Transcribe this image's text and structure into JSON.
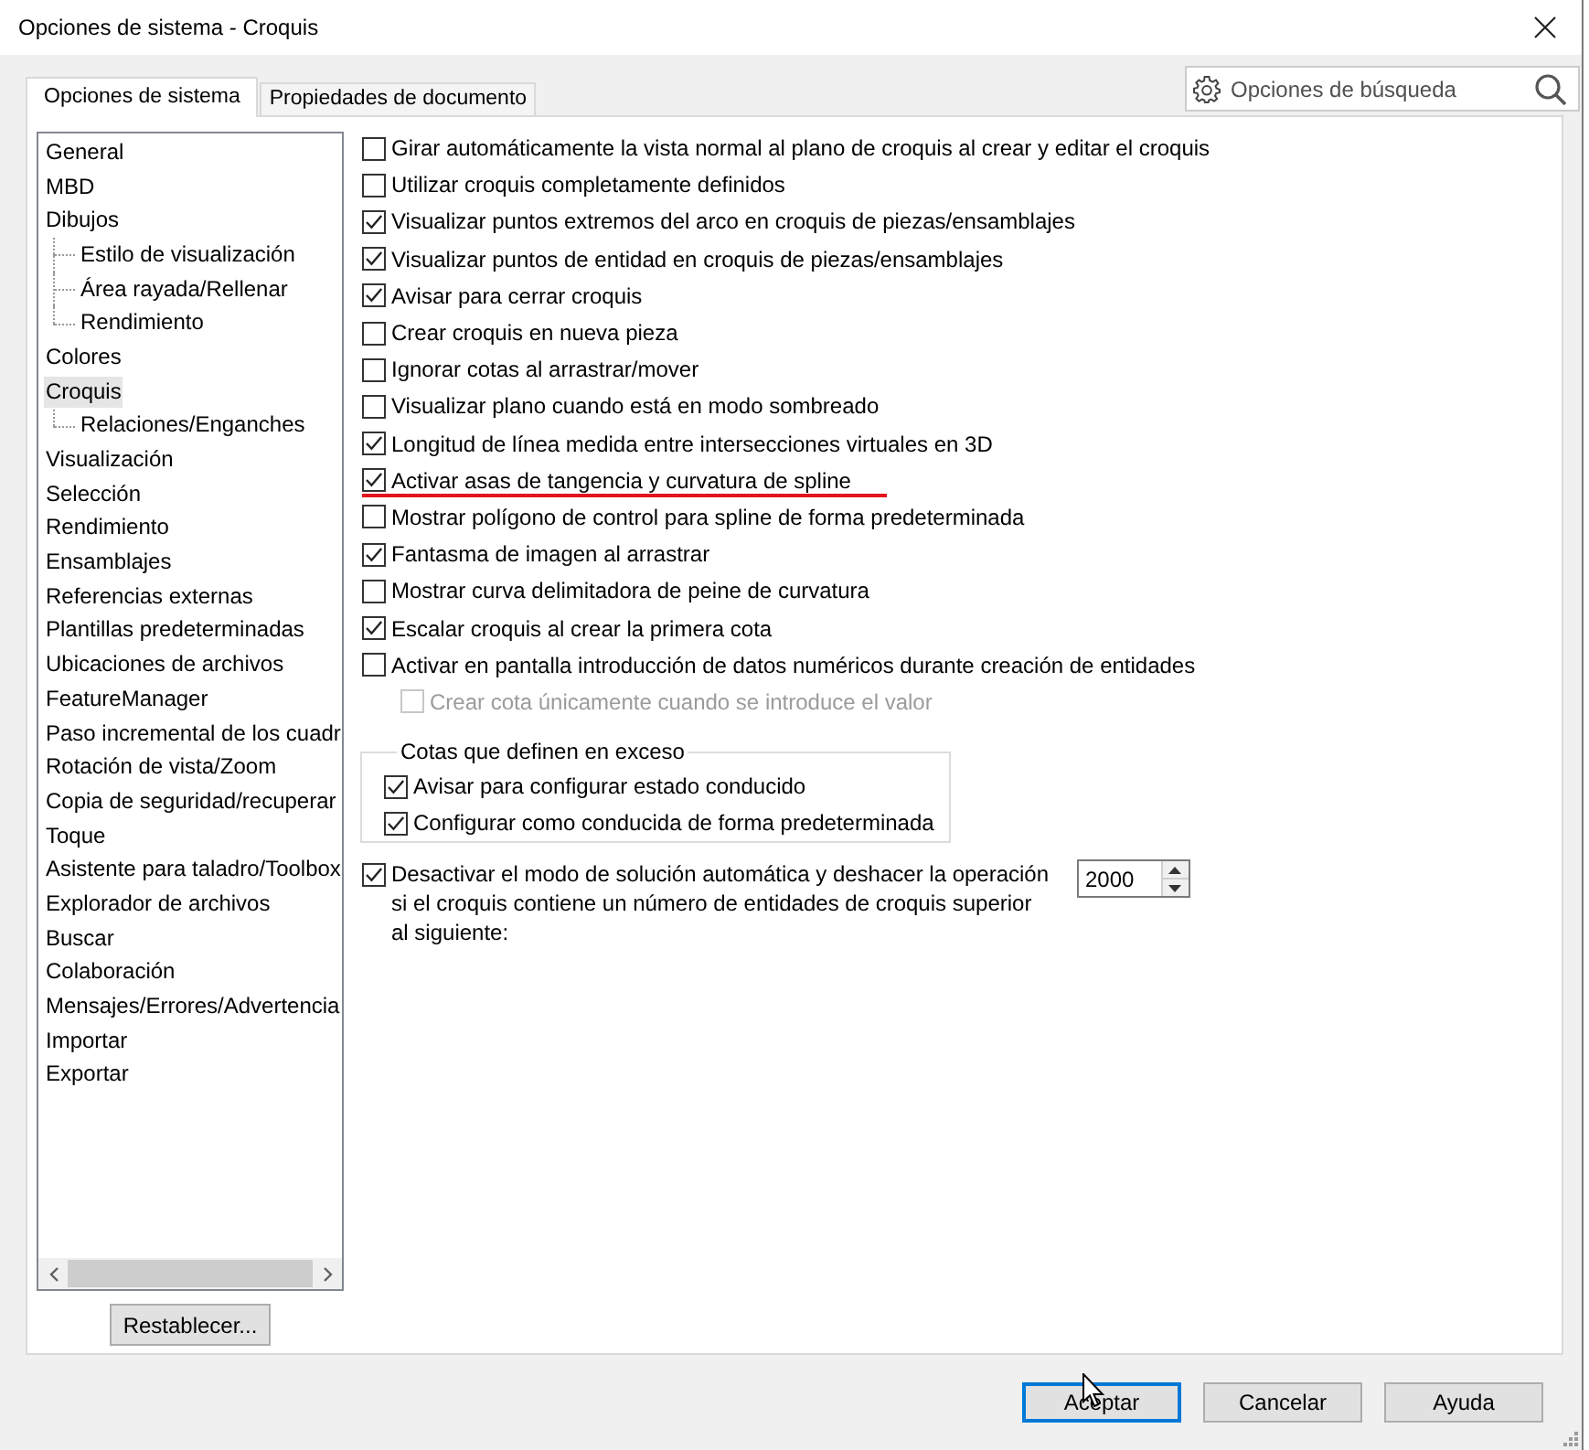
{
  "window": {
    "title": "Opciones de sistema - Croquis"
  },
  "tabs": [
    {
      "label": "Opciones de sistema",
      "selected": true
    },
    {
      "label": "Propiedades de documento",
      "selected": false
    }
  ],
  "search": {
    "placeholder": "Opciones de búsqueda"
  },
  "sidebar": {
    "items": [
      {
        "label": "General",
        "selected": false
      },
      {
        "label": "MBD",
        "selected": false
      },
      {
        "label": "Dibujos",
        "selected": false,
        "children": [
          {
            "label": "Estilo de visualización",
            "selected": false
          },
          {
            "label": "Área rayada/Rellenar",
            "selected": false
          },
          {
            "label": "Rendimiento",
            "selected": false
          }
        ]
      },
      {
        "label": "Colores",
        "selected": false
      },
      {
        "label": "Croquis",
        "selected": true,
        "children": [
          {
            "label": "Relaciones/Enganches",
            "selected": false
          }
        ]
      },
      {
        "label": "Visualización",
        "selected": false
      },
      {
        "label": "Selección",
        "selected": false
      },
      {
        "label": "Rendimiento",
        "selected": false
      },
      {
        "label": "Ensamblajes",
        "selected": false
      },
      {
        "label": "Referencias externas",
        "selected": false
      },
      {
        "label": "Plantillas predeterminadas",
        "selected": false
      },
      {
        "label": "Ubicaciones de archivos",
        "selected": false
      },
      {
        "label": "FeatureManager",
        "selected": false
      },
      {
        "label": "Paso incremental de los cuadr",
        "selected": false
      },
      {
        "label": "Rotación de vista/Zoom",
        "selected": false
      },
      {
        "label": "Copia de seguridad/recuperar",
        "selected": false
      },
      {
        "label": "Toque",
        "selected": false
      },
      {
        "label": "Asistente para taladro/Toolbox",
        "selected": false
      },
      {
        "label": "Explorador de archivos",
        "selected": false
      },
      {
        "label": "Buscar",
        "selected": false
      },
      {
        "label": "Colaboración",
        "selected": false
      },
      {
        "label": "Mensajes/Errores/Advertencia",
        "selected": false
      },
      {
        "label": "Importar",
        "selected": false
      },
      {
        "label": "Exportar",
        "selected": false
      }
    ]
  },
  "options": [
    {
      "label": "Girar automáticamente la vista normal al plano de croquis al crear y editar el croquis",
      "checked": false,
      "disabled": false,
      "underlined": false
    },
    {
      "label": "Utilizar croquis completamente definidos",
      "checked": false,
      "disabled": false,
      "underlined": false
    },
    {
      "label": "Visualizar puntos extremos del arco en croquis de piezas/ensamblajes",
      "checked": true,
      "disabled": false,
      "underlined": false
    },
    {
      "label": "Visualizar puntos de entidad en croquis de piezas/ensamblajes",
      "checked": true,
      "disabled": false,
      "underlined": false
    },
    {
      "label": "Avisar para cerrar croquis",
      "checked": true,
      "disabled": false,
      "underlined": false
    },
    {
      "label": "Crear croquis en nueva pieza",
      "checked": false,
      "disabled": false,
      "underlined": false
    },
    {
      "label": "Ignorar cotas al arrastrar/mover",
      "checked": false,
      "disabled": false,
      "underlined": false
    },
    {
      "label": "Visualizar plano cuando está en modo sombreado",
      "checked": false,
      "disabled": false,
      "underlined": false
    },
    {
      "label": "Longitud de línea medida entre intersecciones virtuales en 3D",
      "checked": true,
      "disabled": false,
      "underlined": false
    },
    {
      "label": "Activar asas de tangencia y curvatura de spline",
      "checked": true,
      "disabled": false,
      "underlined": true
    },
    {
      "label": "Mostrar polígono de control para spline de forma predeterminada",
      "checked": false,
      "disabled": false,
      "underlined": false
    },
    {
      "label": "Fantasma de imagen al arrastrar",
      "checked": true,
      "disabled": false,
      "underlined": false
    },
    {
      "label": "Mostrar curva delimitadora de peine de curvatura",
      "checked": false,
      "disabled": false,
      "underlined": false
    },
    {
      "label": "Escalar croquis al crear la primera cota",
      "checked": true,
      "disabled": false,
      "underlined": false
    },
    {
      "label": "Activar en pantalla introducción de datos numéricos durante creación de entidades",
      "checked": false,
      "disabled": false,
      "underlined": false,
      "children": [
        {
          "label": "Crear cota únicamente cuando se introduce el valor",
          "checked": false,
          "disabled": true,
          "underlined": false
        }
      ]
    }
  ],
  "group": {
    "title": "Cotas que definen en exceso",
    "options": [
      {
        "label": "Avisar para configurar estado conducido",
        "checked": true
      },
      {
        "label": "Configurar como conducida de forma predeterminada",
        "checked": true
      }
    ]
  },
  "auto_solve_limit": {
    "label": "Desactivar el modo de solución automática y deshacer la operación si el croquis contiene un número de entidades de croquis superior al siguiente:",
    "checked": true,
    "value": "2000"
  },
  "reset_button": {
    "label": "Restablecer..."
  },
  "buttons": [
    {
      "label": "Aceptar",
      "focused": true
    },
    {
      "label": "Cancelar",
      "focused": false
    },
    {
      "label": "Ayuda",
      "focused": false
    }
  ]
}
